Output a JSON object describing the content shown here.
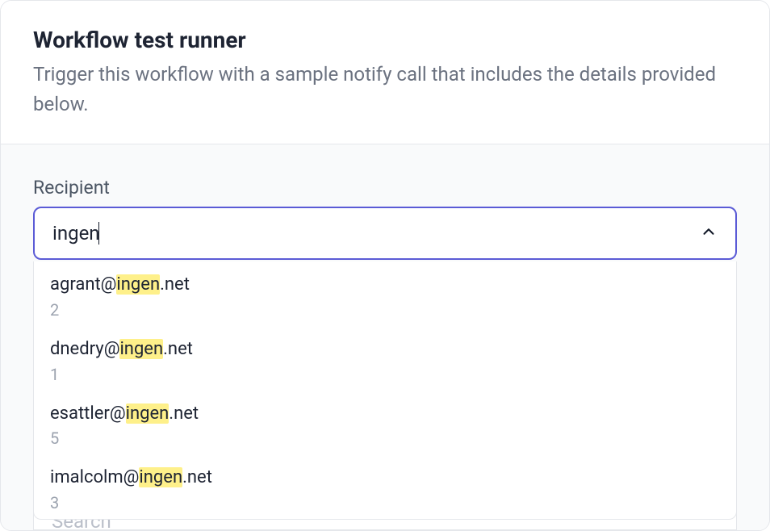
{
  "header": {
    "title": "Workflow test runner",
    "description": "Trigger this workflow with a sample notify call that includes the details provided below."
  },
  "recipient": {
    "label": "Recipient",
    "query": "ingen",
    "options": [
      {
        "prefix": "agrant@",
        "match": "ingen",
        "suffix": ".net",
        "count": "2"
      },
      {
        "prefix": "dnedry@",
        "match": "ingen",
        "suffix": ".net",
        "count": "1"
      },
      {
        "prefix": "esattler@",
        "match": "ingen",
        "suffix": ".net",
        "count": "5"
      },
      {
        "prefix": "imalcolm@",
        "match": "ingen",
        "suffix": ".net",
        "count": "3"
      }
    ]
  },
  "secondary": {
    "placeholder": "Search"
  }
}
